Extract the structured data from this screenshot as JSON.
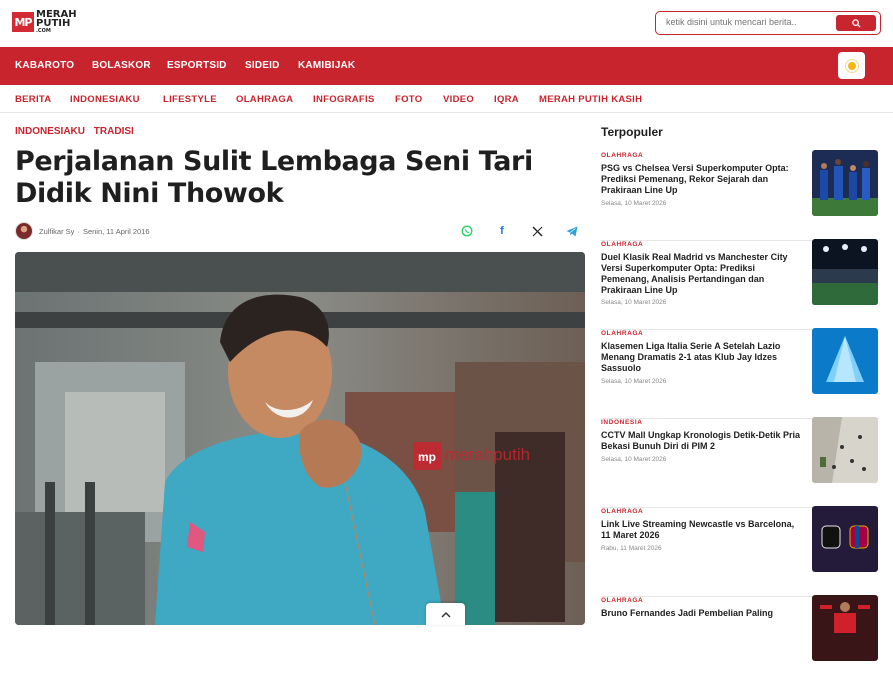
{
  "header": {
    "logo_mark": "MP",
    "logo_line1": "MERAH",
    "logo_line2": "PUTIH",
    "logo_line3": ".COM",
    "search_placeholder": "ketik disini untuk mencari berita.."
  },
  "main_nav": [
    "KABAROTO",
    "BOLASKOR",
    "ESPORTSID",
    "SIDEID",
    "KAMIBIJAK"
  ],
  "sub_nav": [
    "BERITA",
    "INDONESIAKU",
    "LIFESTYLE",
    "OLAHRAGA",
    "INFOGRAFIS",
    "FOTO",
    "VIDEO",
    "IQRA",
    "MERAH PUTIH KASIH"
  ],
  "article": {
    "tags": [
      "INDONESIAKU",
      "TRADISI"
    ],
    "title": "Perjalanan Sulit Lembaga Seni Tari Didik Nini Thowok",
    "author": "Zulfikar Sy",
    "date": "Senin, 11 April 2016",
    "watermark": "merahputih"
  },
  "sidebar": {
    "title": "Terpopuler",
    "items": [
      {
        "category": "OLAHRAGA",
        "headline": "PSG vs Chelsea Versi Superkomputer Opta: Prediksi Pemenang, Rekor Sejarah dan Prakiraan Line Up",
        "date": "Selasa, 10 Maret 2026"
      },
      {
        "category": "OLAHRAGA",
        "headline": "Duel Klasik Real Madrid vs Manchester City Versi Superkomputer Opta: Prediksi Pemenang, Analisis Pertandingan dan Prakiraan Line Up",
        "date": "Selasa, 10 Maret 2026"
      },
      {
        "category": "OLAHRAGA",
        "headline": "Klasemen Liga Italia Serie A Setelah Lazio Menang Dramatis 2-1 atas Klub Jay Idzes Sassuolo",
        "date": "Selasa, 10 Maret 2026"
      },
      {
        "category": "INDONESIA",
        "headline": "CCTV Mall Ungkap Kronologis Detik-Detik Pria Bekasi Bunuh Diri di PIM 2",
        "date": "Selasa, 10 Maret 2026"
      },
      {
        "category": "OLAHRAGA",
        "headline": "Link Live Streaming Newcastle vs Barcelona, 11 Maret 2026",
        "date": "Rabu, 11 Maret 2026"
      },
      {
        "category": "OLAHRAGA",
        "headline": "Bruno Fernandes Jadi Pembelian Paling",
        "date": ""
      }
    ]
  },
  "colors": {
    "brand_red": "#c8242e",
    "text_dark": "#1f1f1f"
  }
}
